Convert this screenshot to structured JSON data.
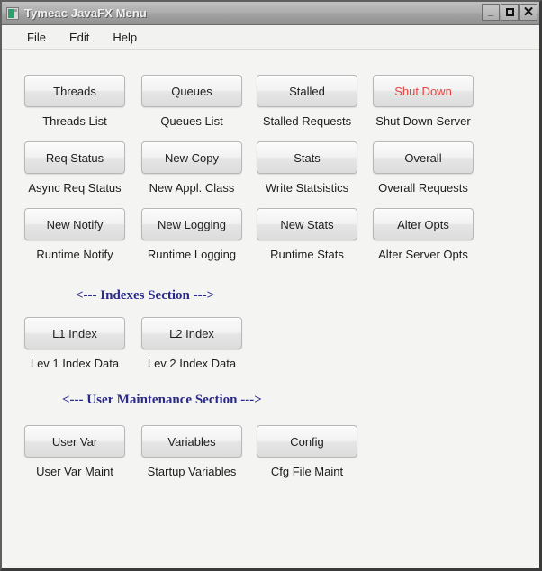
{
  "window": {
    "title": "Tymeac JavaFX Menu",
    "icon": "app-icon",
    "controls": {
      "minimize": "_",
      "maximize": "□",
      "close": "✕"
    }
  },
  "menubar": {
    "items": [
      {
        "label": "File"
      },
      {
        "label": "Edit"
      },
      {
        "label": "Help"
      }
    ]
  },
  "colors": {
    "background": "#f4f4f2",
    "titlebar": "#a8a8a8",
    "section_heading": "#2a2a8c",
    "danger_text": "#e8423f",
    "button_face": "#ececec"
  },
  "main": {
    "rows": [
      {
        "name": "row-1",
        "cells": [
          {
            "button": "Threads",
            "caption": "Threads List",
            "danger": false
          },
          {
            "button": "Queues",
            "caption": "Queues List",
            "danger": false
          },
          {
            "button": "Stalled",
            "caption": "Stalled Requests",
            "danger": false
          },
          {
            "button": "Shut Down",
            "caption": "Shut Down Server",
            "danger": true
          }
        ]
      },
      {
        "name": "row-2",
        "cells": [
          {
            "button": "Req Status",
            "caption": "Async Req Status",
            "danger": false
          },
          {
            "button": "New Copy",
            "caption": "New Appl. Class",
            "danger": false
          },
          {
            "button": "Stats",
            "caption": "Write Statsistics",
            "danger": false
          },
          {
            "button": "Overall",
            "caption": "Overall Requests",
            "danger": false
          }
        ]
      },
      {
        "name": "row-3",
        "cells": [
          {
            "button": "New Notify",
            "caption": "Runtime Notify",
            "danger": false
          },
          {
            "button": "New Logging",
            "caption": "Runtime Logging",
            "danger": false
          },
          {
            "button": "New Stats",
            "caption": "Runtime Stats",
            "danger": false
          },
          {
            "button": "Alter Opts",
            "caption": "Alter Server Opts",
            "danger": false
          }
        ]
      }
    ],
    "indexes_section": {
      "heading": "<--- Indexes Section --->",
      "cells": [
        {
          "button": "L1 Index",
          "caption": "Lev 1 Index Data"
        },
        {
          "button": "L2 Index",
          "caption": "Lev 2 Index Data"
        }
      ]
    },
    "user_maintenance_section": {
      "heading": "<--- User Maintenance Section --->",
      "cells": [
        {
          "button": "User Var",
          "caption": "User Var Maint"
        },
        {
          "button": "Variables",
          "caption": "Startup Variables"
        },
        {
          "button": "Config",
          "caption": "Cfg File Maint"
        }
      ]
    }
  }
}
